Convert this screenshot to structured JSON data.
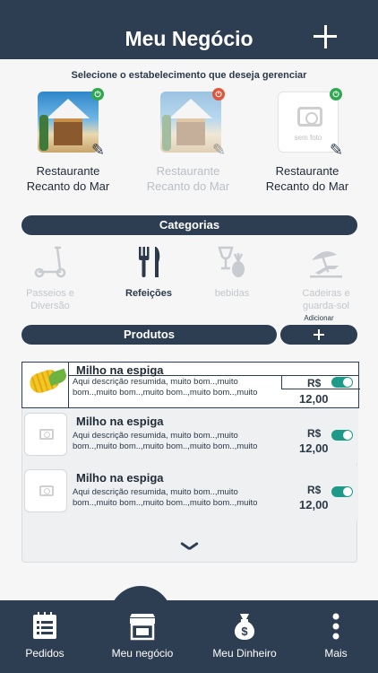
{
  "header": {
    "title": "Meu Negócio",
    "add_icon": "plus-icon"
  },
  "stores": {
    "subtitle": "Selecione o estabelecimento que deseja gerenciar",
    "items": [
      {
        "name_line1": "Restaurante",
        "name_line2": "Recanto do Mar",
        "status": "on",
        "image": "beach-restaurant-photo",
        "faded": false
      },
      {
        "name_line1": "Restaurante",
        "name_line2": "Recanto do Mar",
        "status": "off",
        "image": "beach-restaurant-photo",
        "faded": true
      },
      {
        "name_line1": "Restaurante",
        "name_line2": "Recanto do Mar",
        "status": "on",
        "image": "no-photo",
        "no_photo_label": "sem foto",
        "faded": false
      }
    ]
  },
  "categories": {
    "title": "Categorias",
    "items": [
      {
        "label_line1": "Passeios e",
        "label_line2": "Diversão",
        "icon": "scooter-icon",
        "active": false
      },
      {
        "label_line1": "Refeições",
        "label_line2": "",
        "icon": "fork-knife-icon",
        "active": true
      },
      {
        "label_line1": "bebidas",
        "label_line2": "",
        "icon": "drink-icon",
        "active": false
      },
      {
        "label_line1": "Cadeiras e",
        "label_line2": "guarda-sol",
        "icon": "beach-chair-icon",
        "active": false
      }
    ]
  },
  "products": {
    "title": "Produtos",
    "add_label": "Adicionar",
    "items": [
      {
        "name": "Milho na espiga",
        "desc_line1": "Aqui descrição resumida, muito bom..,muito",
        "desc_line2": "bom..,muito bom..,muito bom..,muito bom..,muito",
        "currency": "R$",
        "price": "12,00",
        "enabled": true,
        "image": "corn"
      },
      {
        "name": "Milho na espiga",
        "desc_line1": "Aqui descrição resumida, muito bom..,muito",
        "desc_line2": "bom..,muito bom..,muito bom..,muito bom..,muito",
        "currency": "R$",
        "price": "12,00",
        "enabled": true,
        "image": "no-photo"
      },
      {
        "name": "Milho na espiga",
        "desc_line1": "Aqui descrição resumida, muito bom..,muito",
        "desc_line2": "bom..,muito bom..,muito bom..,muito bom..,muito",
        "currency": "R$",
        "price": "12,00",
        "enabled": true,
        "image": "no-photo"
      }
    ]
  },
  "bottom_nav": {
    "items": [
      {
        "label": "Pedidos",
        "icon": "orders-list-icon"
      },
      {
        "label": "Meu negócio",
        "icon": "storefront-icon",
        "active": true
      },
      {
        "label": "Meu Dinheiro",
        "icon": "money-bag-icon"
      },
      {
        "label": "Mais",
        "icon": "more-vertical-icon"
      }
    ]
  },
  "colors": {
    "primary": "#2e3e52",
    "toggle_on": "#1e9a88",
    "status_on": "#2fa84f",
    "status_off": "#e0563c"
  }
}
